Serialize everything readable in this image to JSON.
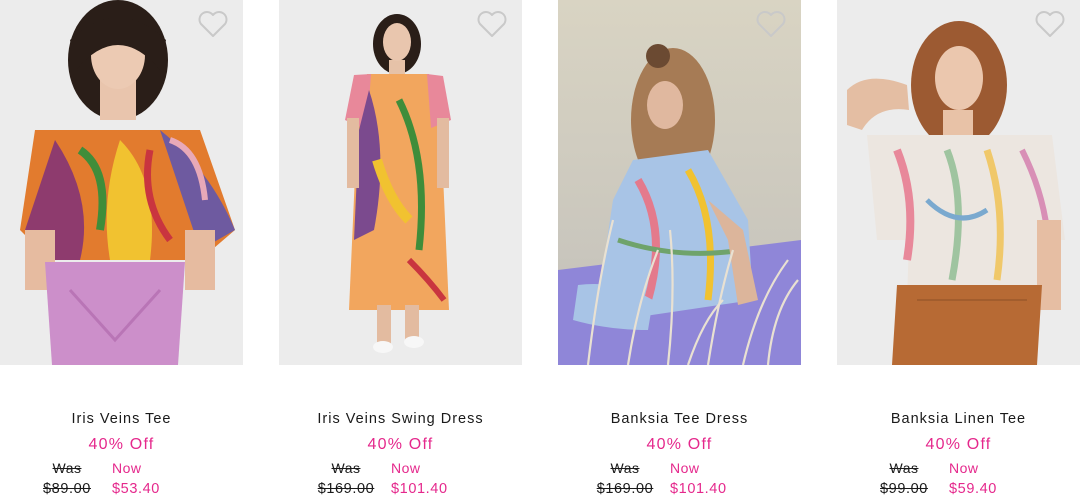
{
  "products": [
    {
      "name": "Iris Veins Tee",
      "discount": "40% Off",
      "was_label": "Was",
      "was_price": "$89.00",
      "now_label": "Now",
      "now_price": "$53.40",
      "photo": "model-in-iris-veins-tee"
    },
    {
      "name": "Iris Veins Swing Dress",
      "discount": "40% Off",
      "was_label": "Was",
      "was_price": "$169.00",
      "now_label": "Now",
      "now_price": "$101.40",
      "photo": "model-in-iris-veins-swing-dress"
    },
    {
      "name": "Banksia Tee Dress",
      "discount": "40% Off",
      "was_label": "Was",
      "was_price": "$169.00",
      "now_label": "Now",
      "now_price": "$101.40",
      "photo": "model-in-banksia-tee-dress"
    },
    {
      "name": "Banksia Linen Tee",
      "discount": "40% Off",
      "was_label": "Was",
      "was_price": "$99.00",
      "now_label": "Now",
      "now_price": "$59.40",
      "photo": "model-in-banksia-linen-tee"
    }
  ],
  "icons": {
    "favourite": "heart-outline-icon"
  },
  "colors": {
    "sale_pink": "#e5288c",
    "text": "#1a1a1a",
    "heart": "#c9c9c9"
  }
}
